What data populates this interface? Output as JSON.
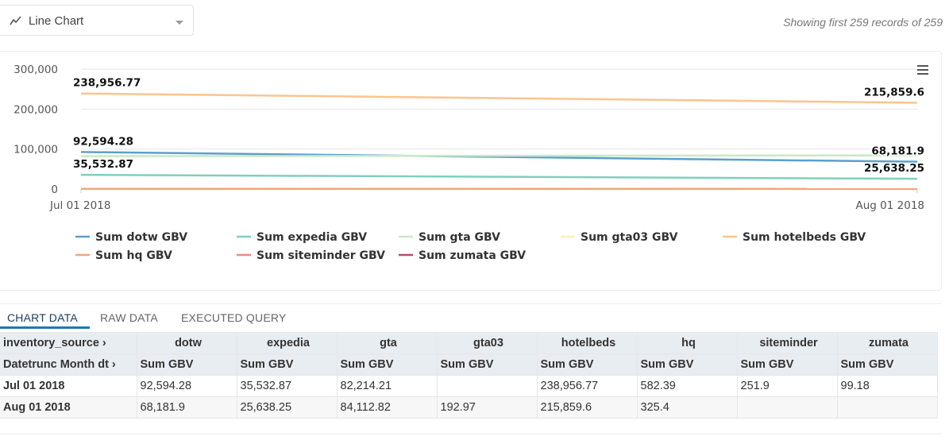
{
  "viz_selector": {
    "label": "Line Chart",
    "icon": "line-chart-icon"
  },
  "records_text": "Showing first 259 records of 259",
  "chart_data": {
    "type": "line",
    "x": [
      "Jul 01 2018",
      "Aug 01 2018"
    ],
    "ylim": [
      0,
      300000
    ],
    "yticks": [
      0,
      100000,
      200000,
      300000
    ],
    "ytick_labels": [
      "0",
      "100,000",
      "200,000",
      "300,000"
    ],
    "grid": true,
    "legend_position": "bottom",
    "series": [
      {
        "name": "Sum dotw GBV",
        "color": "#5b9fcf",
        "values": [
          92594.28,
          68181.9
        ],
        "labels": [
          "92,594.28",
          "68,181.9"
        ]
      },
      {
        "name": "Sum expedia GBV",
        "color": "#7fd0bc",
        "values": [
          35532.87,
          25638.25
        ],
        "labels": [
          "35,532.87",
          "25,638.25"
        ]
      },
      {
        "name": "Sum gta GBV",
        "color": "#c9e9c4",
        "values": [
          82214.21,
          84112.82
        ],
        "labels": [
          "",
          ""
        ]
      },
      {
        "name": "Sum gta03 GBV",
        "color": "#fbefbf",
        "values": [
          null,
          192.97
        ],
        "labels": [
          "",
          ""
        ]
      },
      {
        "name": "Sum hotelbeds GBV",
        "color": "#fcc48e",
        "values": [
          238956.77,
          215859.6
        ],
        "labels": [
          "238,956.77",
          "215,859.6"
        ]
      },
      {
        "name": "Sum hq GBV",
        "color": "#f5a57a",
        "values": [
          582.39,
          325.4
        ],
        "labels": [
          "",
          ""
        ]
      },
      {
        "name": "Sum siteminder GBV",
        "color": "#ee8a7c",
        "values": [
          251.9,
          null
        ],
        "labels": [
          "",
          ""
        ]
      },
      {
        "name": "Sum zumata GBV",
        "color": "#c2476d",
        "values": [
          99.18,
          null
        ],
        "labels": [
          "",
          ""
        ]
      }
    ]
  },
  "tabs": [
    {
      "label": "CHART DATA",
      "active": true
    },
    {
      "label": "RAW DATA",
      "active": false
    },
    {
      "label": "EXECUTED QUERY",
      "active": false
    }
  ],
  "table": {
    "pivot_label": "inventory_source ›",
    "row_label": "Datetrunc Month dt ›",
    "sources": [
      "dotw",
      "expedia",
      "gta",
      "gta03",
      "hotelbeds",
      "hq",
      "siteminder",
      "zumata"
    ],
    "metric": "Sum GBV",
    "rows": [
      {
        "date": "Jul 01 2018",
        "values": [
          "92,594.28",
          "35,532.87",
          "82,214.21",
          "",
          "238,956.77",
          "582.39",
          "251.9",
          "99.18"
        ]
      },
      {
        "date": "Aug 01 2018",
        "values": [
          "68,181.9",
          "25,638.25",
          "84,112.82",
          "192.97",
          "215,859.6",
          "325.4",
          "",
          ""
        ]
      }
    ]
  }
}
